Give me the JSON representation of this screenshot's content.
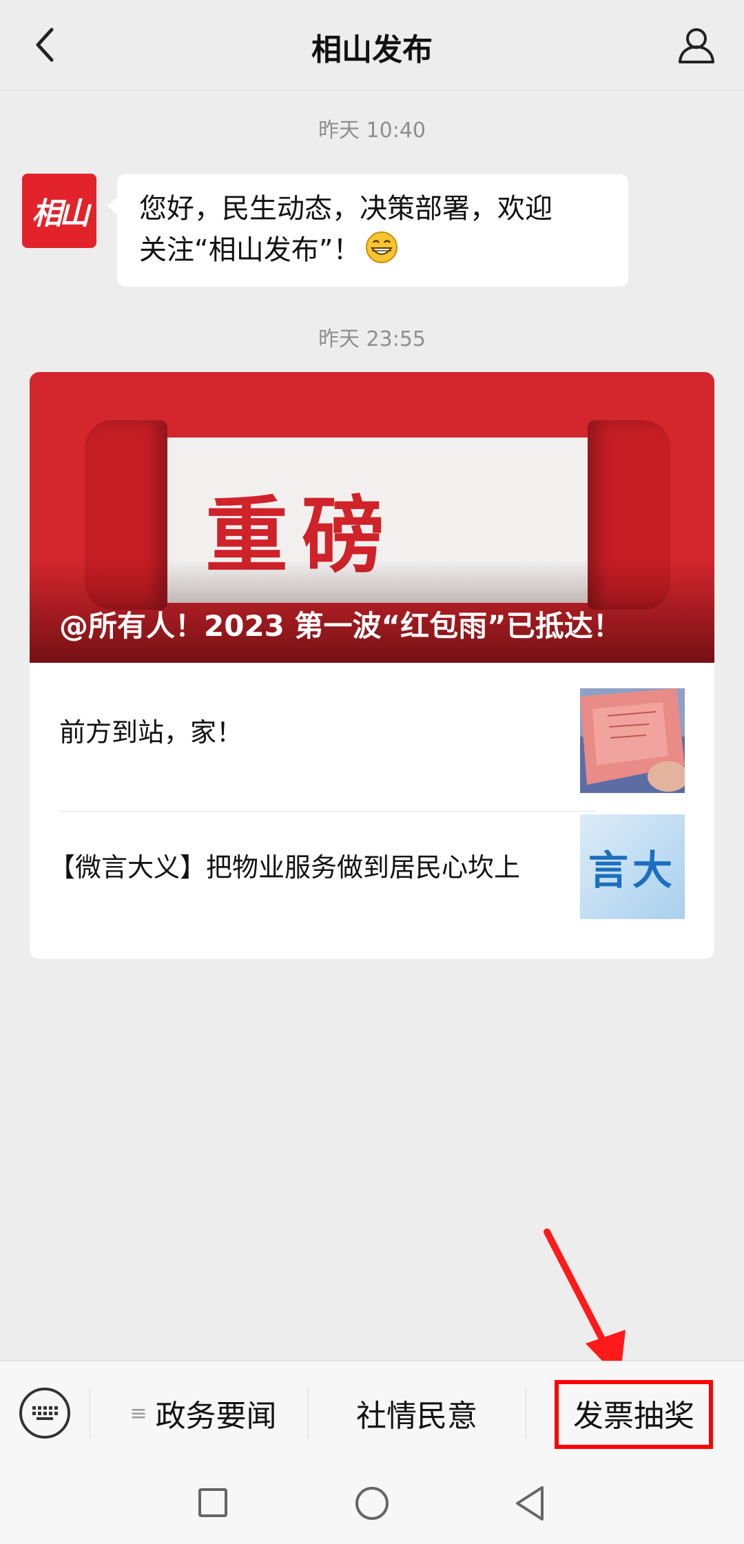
{
  "header": {
    "title": "相山发布"
  },
  "chat": {
    "time1": "昨天 10:40",
    "avatar_text": "相山",
    "welcome_line1": "您好，民生动态，决策部署，欢迎",
    "welcome_line2": "关注“相山发布”！",
    "time2": "昨天 23:55",
    "article": {
      "banner_art_text": "重磅",
      "headline": "@所有人！2023 第一波“红包雨”已抵达！",
      "items": [
        {
          "title": "前方到站，家！",
          "thumb_icon": "id-card-photo"
        },
        {
          "title": "【微言大义】把物业服务做到居民心坎上",
          "thumb_icon": "weiyan-dayi-graphic",
          "thumb_text": "言大"
        }
      ]
    }
  },
  "menu": {
    "items": [
      {
        "label": "政务要闻",
        "icon": "list-icon"
      },
      {
        "label": "社情民意"
      },
      {
        "label": "发票抽奖",
        "highlighted": true
      }
    ],
    "highlight_color": "#ff0000"
  },
  "colors": {
    "brand_red": "#e2232b",
    "background": "#ededed"
  }
}
